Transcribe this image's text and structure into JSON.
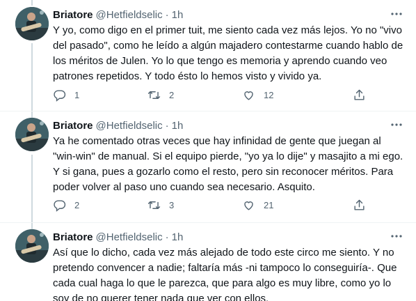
{
  "tweets": [
    {
      "name": "Briatore",
      "handle": "@Hetfieldselic",
      "dot": "·",
      "time": "1h",
      "text": "Y yo, como digo en el primer tuit, me siento cada vez más lejos. Yo no \"vivo del pasado\", como he leído a algún majadero contestarme cuando hablo de los méritos de Julen. Yo lo que tengo es memoria y aprendo cuando veo patrones repetidos. Y todo ésto lo hemos visto y vivido ya.",
      "replies": "1",
      "retweets": "2",
      "likes": "12"
    },
    {
      "name": "Briatore",
      "handle": "@Hetfieldselic",
      "dot": "·",
      "time": "1h",
      "text": "Ya he comentado otras veces que hay infinidad de gente que juegan al \"win-win\" de manual. Si el equipo pierde, \"yo ya lo dije\" y masajito a mi ego. Y si gana, pues a gozarlo como el resto, pero sin reconocer méritos. Para poder volver al paso uno cuando sea necesario. Asquito.",
      "replies": "2",
      "retweets": "3",
      "likes": "21"
    },
    {
      "name": "Briatore",
      "handle": "@Hetfieldselic",
      "dot": "·",
      "time": "1h",
      "text": "Así que lo dicho, cada vez más alejado de todo este circo me siento. Y no pretendo convencer a nadie; faltaría más -ni tampoco lo conseguiría-. Que cada cual haga lo que le parezca, que para algo es muy libre, como yo lo soy de no querer tener nada que ver con ellos."
    }
  ],
  "icons": {
    "more": "more-horizontal-icon",
    "reply": "reply-icon",
    "retweet": "retweet-icon",
    "like": "heart-icon",
    "share": "share-icon"
  },
  "colors": {
    "text": "#0f1419",
    "secondary": "#536471",
    "thread_line": "#cfd9de",
    "divider": "#eff3f4"
  }
}
